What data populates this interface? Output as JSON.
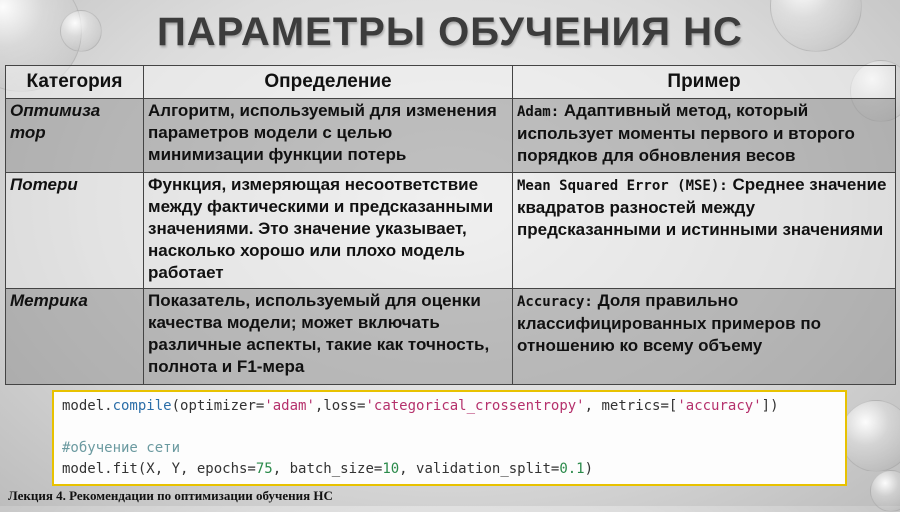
{
  "title": "ПАРАМЕТРЫ ОБУЧЕНИЯ НС",
  "table": {
    "headers": [
      "Категория",
      "Определение",
      "Пример"
    ],
    "rows": [
      {
        "category": "Оптимиза тор",
        "definition": "Алгоритм, используемый для изменения параметров модели с целью минимизации функции потерь",
        "example_lead": "Adam:",
        "example_text": " Адаптивный метод, который использует моменты первого и второго порядков для обновления весов"
      },
      {
        "category": "Потери",
        "definition": "Функция, измеряющая несоответствие между фактическими и предсказанными значениями. Это значение указывает, насколько хорошо или плохо модель работает",
        "example_lead": "Mean Squared Error (MSE):",
        "example_text": " Среднее значение квадратов разностей между предсказанными и истинными значениями"
      },
      {
        "category": "Метрика",
        "definition": "Показатель, используемый для оценки качества модели; может включать различные аспекты, такие как точность, полнота и F1-мера",
        "example_lead": "Accuracy:",
        "example_text": " Доля правильно классифицированных примеров по отношению ко всему объему"
      }
    ]
  },
  "code": {
    "l1_obj": "model.",
    "l1_fn": "compile",
    "l1_a": "(optimizer=",
    "l1_s1": "'adam'",
    "l1_b": ",loss=",
    "l1_s2": "'categorical_crossentropy'",
    "l1_c": ", metrics=[",
    "l1_s3": "'accuracy'",
    "l1_d": "])",
    "comment": "#обучение сети",
    "l3_a": "model.fit(X, Y, epochs=",
    "l3_n1": "75",
    "l3_b": ", batch_size=",
    "l3_n2": "10",
    "l3_c": ", validation_split=",
    "l3_n3": "0.1",
    "l3_d": ")"
  },
  "footer": "Лекция 4. Рекомендации по оптимизации обучения НС"
}
